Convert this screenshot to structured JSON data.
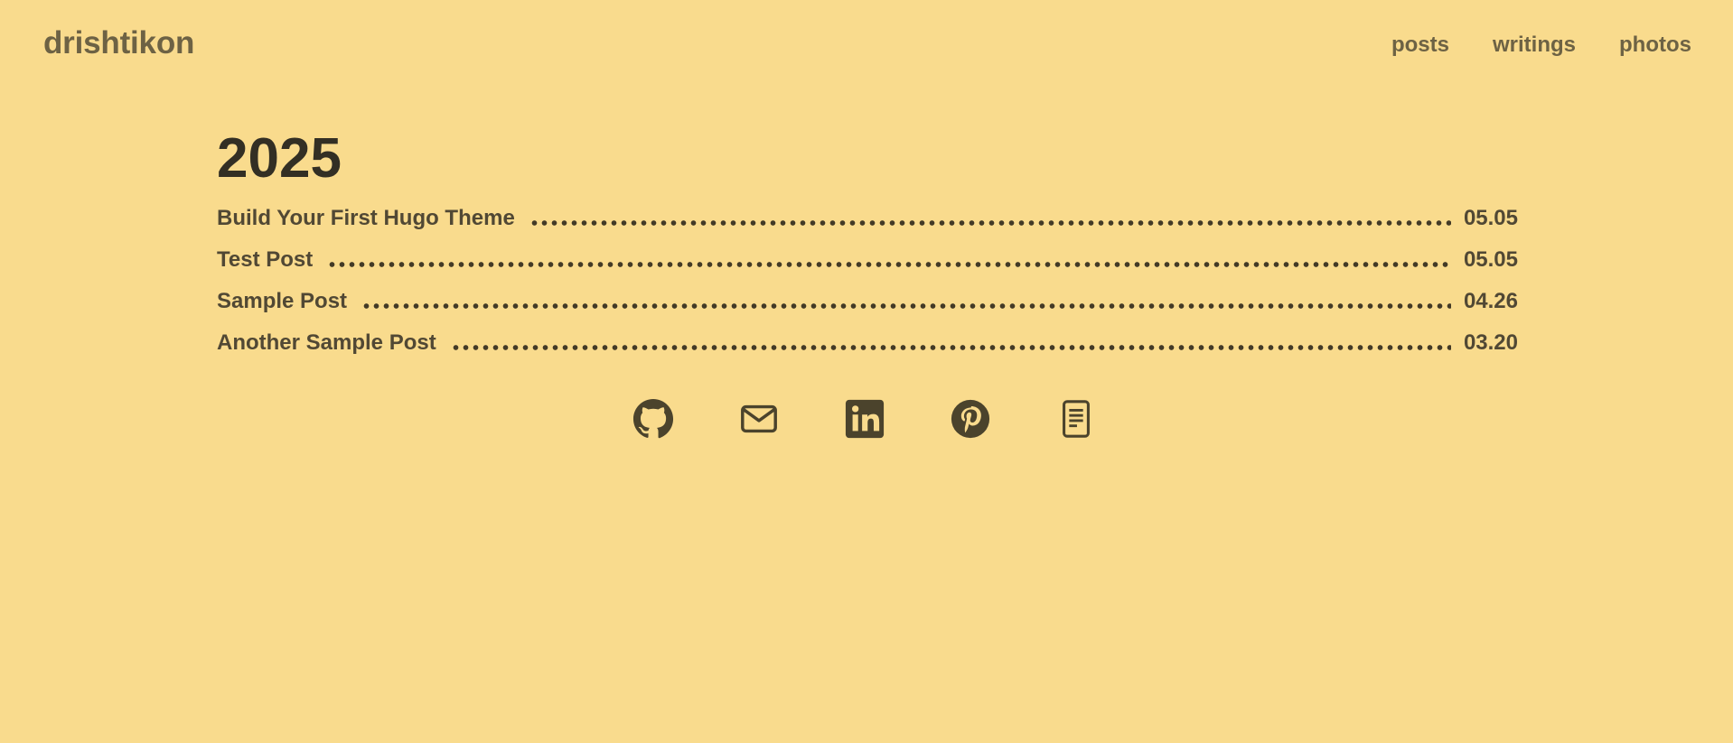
{
  "header": {
    "site_title": "drishtikon",
    "nav": [
      {
        "label": "posts"
      },
      {
        "label": "writings"
      },
      {
        "label": "photos"
      }
    ]
  },
  "main": {
    "year": "2025",
    "posts": [
      {
        "title": "Build Your First Hugo Theme",
        "date": "05.05"
      },
      {
        "title": "Test Post",
        "date": "05.05"
      },
      {
        "title": "Sample Post",
        "date": "04.26"
      },
      {
        "title": "Another Sample Post",
        "date": "03.20"
      }
    ]
  },
  "social": {
    "icons": [
      "github-icon",
      "mail-icon",
      "linkedin-icon",
      "pinterest-icon",
      "document-icon"
    ]
  },
  "colors": {
    "background": "#f9db8d",
    "text": "#4b432c",
    "heading": "#332f24"
  }
}
